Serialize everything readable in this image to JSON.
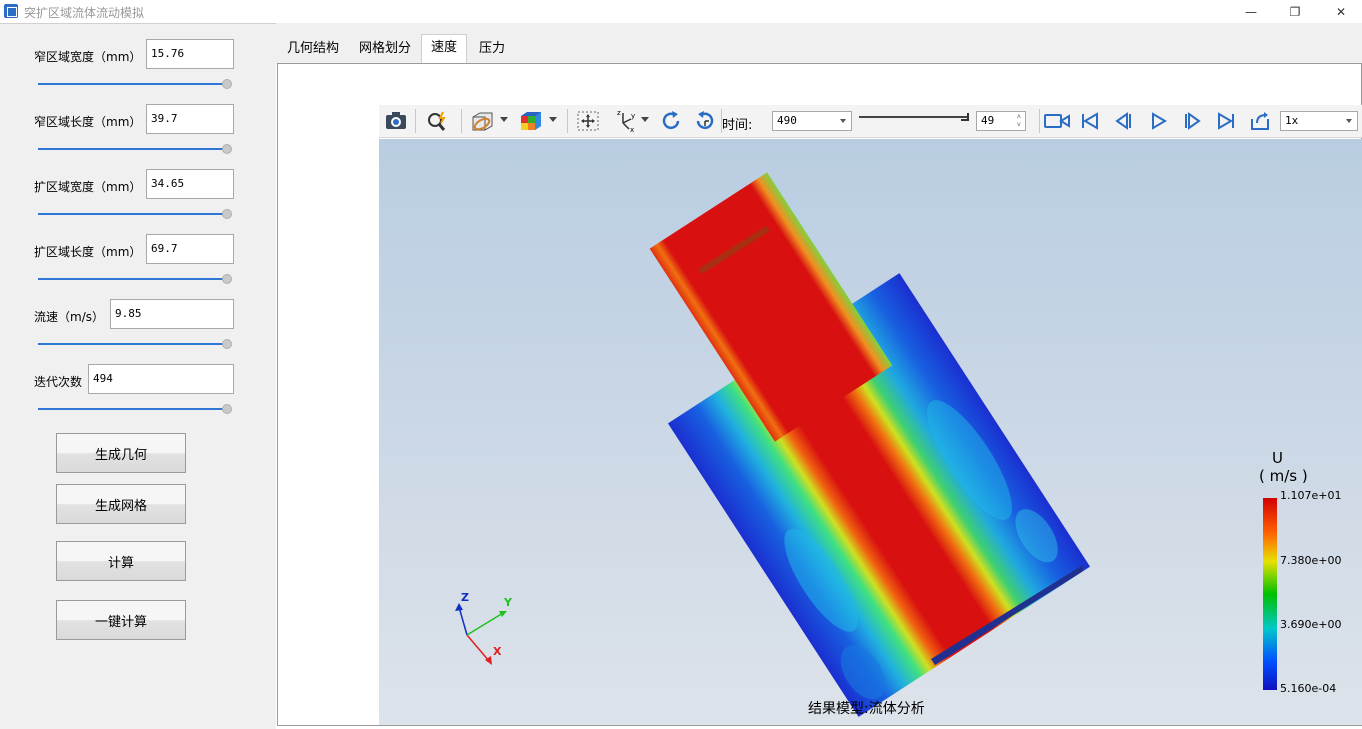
{
  "window": {
    "title": "突扩区域流体流动模拟",
    "minimize": "—",
    "restore": "❐",
    "close": "✕"
  },
  "params": [
    {
      "label": "窄区域宽度（mm）",
      "value": "15.76",
      "slider_fraction": 1.0
    },
    {
      "label": "窄区域长度（mm）",
      "value": "39.7",
      "slider_fraction": 1.0
    },
    {
      "label": "扩区域宽度（mm）",
      "value": "34.65",
      "slider_fraction": 1.0
    },
    {
      "label": "扩区域长度（mm）",
      "value": "69.7",
      "slider_fraction": 1.0
    },
    {
      "label": "流速（m/s）",
      "value": "9.85",
      "slider_fraction": 1.0
    },
    {
      "label": "迭代次数",
      "value": "494",
      "slider_fraction": 1.0
    }
  ],
  "buttons": {
    "generate_geometry": "生成几何",
    "generate_mesh": "生成网格",
    "compute": "计算",
    "one_click_compute": "一键计算"
  },
  "tabs": [
    {
      "label": "几何结构",
      "active": false
    },
    {
      "label": "网格划分",
      "active": false
    },
    {
      "label": "速度",
      "active": true
    },
    {
      "label": "压力",
      "active": false
    }
  ],
  "toolbar": {
    "time_label": "时间:",
    "time_value": "490",
    "frame_value": "49",
    "speed_value": "1x",
    "icons": [
      "camera-icon",
      "zoom-icon",
      "render-mode-icon",
      "color-map-icon",
      "fit-view-icon",
      "axes-icon",
      "rotate-icon",
      "reset-view-icon",
      "record-icon",
      "first-frame-icon",
      "prev-frame-icon",
      "play-icon",
      "next-frame-icon",
      "last-frame-icon",
      "export-icon"
    ]
  },
  "legend": {
    "title": "U",
    "unit": "( m/s )",
    "ticks": [
      "1.107e+01",
      "7.380e+00",
      "3.690e+00",
      "5.160e-04"
    ],
    "colors": [
      "#d40000",
      "#ffa000",
      "#e0e000",
      "#00c000",
      "#00c8c8",
      "#0050ff",
      "#1010c0"
    ]
  },
  "axes": {
    "z": "Z",
    "y": "Y",
    "x": "X"
  },
  "caption": "结果模型:流体分析"
}
